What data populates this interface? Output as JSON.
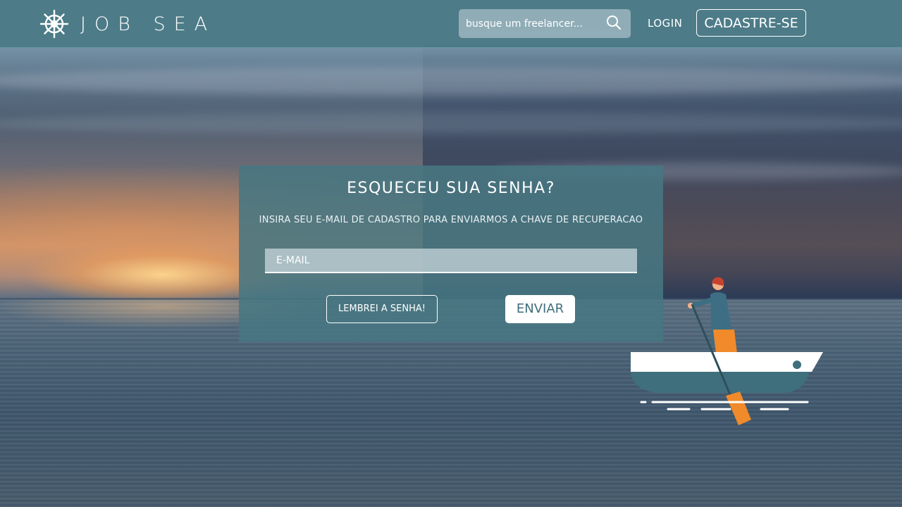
{
  "brand": {
    "name": "JOB SEA"
  },
  "header": {
    "search_placeholder": "busque um freelancer...",
    "login_label": "LOGIN",
    "signup_label": "CADASTRE-SE"
  },
  "recovery": {
    "title": "ESQUECEU SUA SENHA?",
    "subtitle": "INSIRA SEU E-MAIL DE CADASTRO PARA ENVIARMOS A CHAVE DE RECUPERACAO",
    "email_placeholder": "E-MAIL",
    "remember_label": "LEMBREI A SENHA!",
    "send_label": "ENVIAR"
  },
  "colors": {
    "header_bg": "#4a7884",
    "card_bg": "#477682",
    "accent_orange": "#f08a2a",
    "send_text": "#3f6f7c"
  },
  "icons": [
    "helm-icon",
    "search-icon"
  ]
}
